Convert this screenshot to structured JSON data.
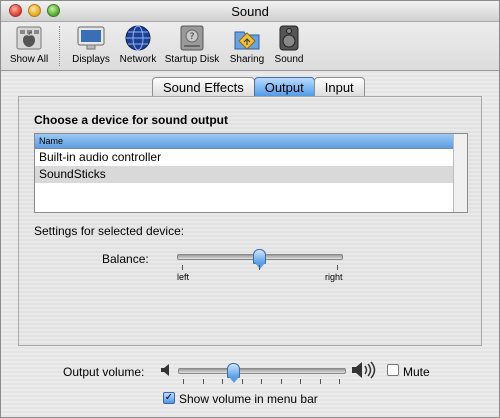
{
  "window": {
    "title": "Sound"
  },
  "toolbar": {
    "items": [
      {
        "label": "Show All",
        "icon": "apple-show-all-icon"
      },
      {
        "label": "Displays",
        "icon": "displays-icon"
      },
      {
        "label": "Network",
        "icon": "network-globe-icon"
      },
      {
        "label": "Startup Disk",
        "icon": "startup-disk-icon"
      },
      {
        "label": "Sharing",
        "icon": "sharing-folder-icon"
      },
      {
        "label": "Sound",
        "icon": "speaker-icon"
      }
    ]
  },
  "tabs": [
    {
      "label": "Sound Effects",
      "active": false
    },
    {
      "label": "Output",
      "active": true
    },
    {
      "label": "Input",
      "active": false
    }
  ],
  "output": {
    "heading": "Choose a device for sound output",
    "column_header": "Name",
    "devices": [
      {
        "name": "Built-in audio controller",
        "selected": false
      },
      {
        "name": "SoundSticks",
        "selected": true
      }
    ],
    "settings_label": "Settings for selected device:",
    "balance_label": "Balance:",
    "balance_left": "left",
    "balance_right": "right",
    "balance_value": 0.5
  },
  "volume": {
    "label": "Output volume:",
    "value": 0.33,
    "mute_label": "Mute",
    "mute_checked": false,
    "show_in_menu_label": "Show volume in menu bar",
    "show_in_menu_checked": true
  }
}
